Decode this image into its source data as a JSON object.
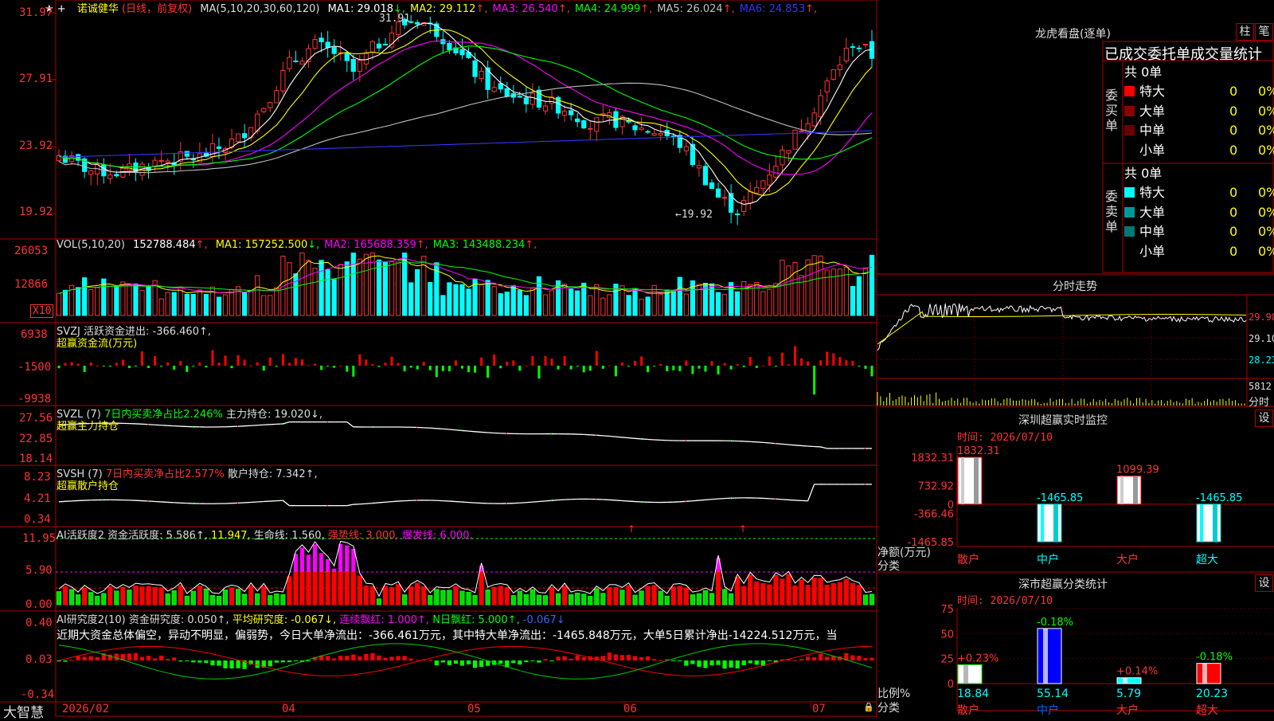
{
  "stock": {
    "name": "诺诚健华",
    "mode": "(日线，前复权)",
    "ma_header": {
      "label": "MA(5,10,20,30,60,120)",
      "items": [
        {
          "text": "MA1: 29.018",
          "arrow": "↓",
          "color": "#ffffff"
        },
        {
          "text": "MA2: 29.112",
          "arrow": "↑",
          "color": "#ffff00"
        },
        {
          "text": "MA3: 26.540",
          "arrow": "↑",
          "color": "#ff00ff"
        },
        {
          "text": "MA4: 24.999",
          "arrow": "↑",
          "color": "#00ff00"
        },
        {
          "text": "MA5: 26.024",
          "arrow": "↑",
          "color": "#c0c0c0"
        },
        {
          "text": "MA6: 24.853",
          "arrow": "↑",
          "color": "#3333ff"
        }
      ]
    },
    "price_axis": [
      "31.97",
      "27.91",
      "23.92",
      "19.92"
    ],
    "high_label": "31.91",
    "low_label": "←19.92"
  },
  "vol": {
    "label": "VOL(5,10,20)",
    "value": "152788.484",
    "items": [
      {
        "text": "MA1: 157252.500",
        "arrow": "↓",
        "color": "#ffff00"
      },
      {
        "text": "MA2: 165688.359",
        "arrow": "↑",
        "color": "#ff00ff"
      },
      {
        "text": "MA3: 143488.234",
        "arrow": "↑",
        "color": "#00ff00"
      }
    ],
    "axis": [
      "26053",
      "12866"
    ],
    "unit": "X10"
  },
  "svzj": {
    "label": "SVZJ  活跃资金进出: -366.460↑,",
    "sub": "超赢资金流(万元)",
    "axis": [
      "6938",
      "-1500",
      "-9938"
    ]
  },
  "svzl": {
    "label": "SVZL (7)",
    "pct": "7日内买卖净占比2.246%",
    "hold": "主力持仓: 19.020↓,",
    "sub": "超赢主力持仓",
    "axis": [
      "27.56",
      "22.85",
      "18.14"
    ]
  },
  "svsh": {
    "label": "SVSH (7)",
    "pct": "7日内买卖净占比2.577%",
    "hold": "散户持仓: 7.342↑,",
    "sub": "超赢散户持仓",
    "axis": [
      "8.23",
      "4.21",
      "0.34"
    ]
  },
  "ai1": {
    "label": "AI活跃度2 资金活跃度: 5.586↑,",
    "v2": "11.947,",
    "v3": "生命线: 1.560,",
    "v4": "强势线: 3.000,",
    "v5": "爆发线: 6.000,",
    "axis": [
      "11.95",
      "5.90",
      "0.00"
    ]
  },
  "ai2": {
    "label": "AI研究度2(10) 资金研究度: 0.050↑,",
    "avg": "平均研究度: -0.067↓,",
    "lian": "连续飘红: 1.000↑,",
    "nday": "N日飘红: 5.000↑,",
    "last": "-0.067↓",
    "desc": "近期大资金总体偏空，异动不明显，偏弱势，今日大单净流出：-366.461万元，其中特大单净流出：-1465.848万元，大单5日累计净出-14224.512万元，当",
    "axis": [
      "0.40",
      "0.03",
      "-0.34"
    ]
  },
  "xaxis": {
    "labels": [
      "2026/02",
      "04",
      "05",
      "06",
      "07"
    ]
  },
  "brand": "大智慧",
  "longhu": {
    "title": "龙虎看盘(逐单)",
    "btn_zhu": "柱",
    "btn_bi": "笔",
    "header": "已成交委托单成交量统计",
    "buy_title": "委买单",
    "sell_title": "委卖单",
    "buy_total": "共 0单",
    "sell_total": "共 0单",
    "buy_rows": [
      {
        "name": "特大",
        "count": "0",
        "pct": "0%",
        "color": "#ff0000"
      },
      {
        "name": "大单",
        "count": "0",
        "pct": "0%",
        "color": "#8b0000"
      },
      {
        "name": "中单",
        "count": "0",
        "pct": "0%",
        "color": "#6a0000"
      },
      {
        "name": "小单",
        "count": "0",
        "pct": "0%",
        "color": ""
      }
    ],
    "sell_rows": [
      {
        "name": "特大",
        "count": "0",
        "pct": "0%",
        "color": "#00ffff"
      },
      {
        "name": "大单",
        "count": "0",
        "pct": "0%",
        "color": "#009999"
      },
      {
        "name": "中单",
        "count": "0",
        "pct": "0%",
        "color": "#007777"
      },
      {
        "name": "小单",
        "count": "0",
        "pct": "0%",
        "color": ""
      }
    ]
  },
  "minute": {
    "title": "分时走势",
    "axis": [
      "29.98",
      "29.10",
      "28.23",
      "5812",
      "分时"
    ]
  },
  "monitor": {
    "title": "深圳超赢实时监控",
    "btn": "设",
    "time": "时间: 2026/07/10",
    "axis": [
      "1832.31",
      "732.92",
      "0",
      "-366.46",
      "-1465.85"
    ],
    "ylabel": "净额(万元)",
    "xlabel": "分类",
    "categories": [
      "散户",
      "中户",
      "大户",
      "超大"
    ],
    "values": [
      1832.31,
      -1465.85,
      1099.39,
      -1465.85
    ],
    "value_labels": [
      "1832.31",
      "-1465.85",
      "1099.39",
      "-1465.85"
    ]
  },
  "stats": {
    "title": "深市超赢分类统计",
    "btn": "设",
    "time": "时间: 2026/07/10",
    "axis": [
      "75",
      "50",
      "25",
      "0"
    ],
    "ylabel": "比例%",
    "xlabel": "分类",
    "categories": [
      "散户",
      "中户",
      "大户",
      "超大"
    ],
    "values": [
      18.84,
      55.14,
      5.79,
      20.23
    ],
    "value_labels": [
      "18.84",
      "55.14",
      "5.79",
      "20.23"
    ],
    "change_labels": [
      "+0.23%",
      "-0.18%",
      "+0.14%",
      "-0.18%"
    ]
  },
  "chart_data": [
    {
      "type": "bar",
      "title": "深圳超赢实时监控",
      "ylabel": "净额(万元)",
      "xlabel": "分类",
      "categories": [
        "散户",
        "中户",
        "大户",
        "超大"
      ],
      "values": [
        1832.31,
        -1465.85,
        1099.39,
        -1465.85
      ],
      "ylim": [
        -1465.85,
        1832.31
      ]
    },
    {
      "type": "bar",
      "title": "深市超赢分类统计",
      "ylabel": "比例%",
      "xlabel": "分类",
      "categories": [
        "散户",
        "中户",
        "大户",
        "超大"
      ],
      "values": [
        18.84,
        55.14,
        5.79,
        20.23
      ],
      "ylim": [
        0,
        75
      ]
    }
  ]
}
